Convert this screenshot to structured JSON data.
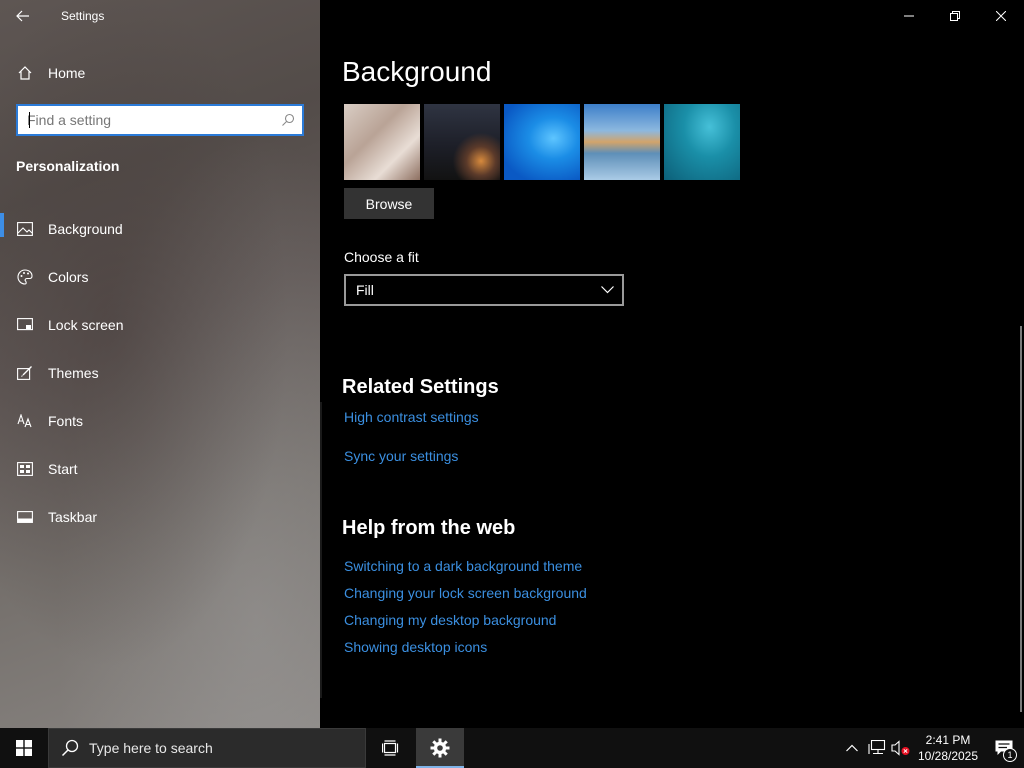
{
  "window": {
    "app_title": "Settings",
    "controls": [
      "minimize",
      "restore",
      "close"
    ]
  },
  "sidebar": {
    "home_label": "Home",
    "search_placeholder": "Find a setting",
    "section_title": "Personalization",
    "items": [
      {
        "label": "Background",
        "icon": "picture-icon",
        "active": true
      },
      {
        "label": "Colors",
        "icon": "palette-icon",
        "active": false
      },
      {
        "label": "Lock screen",
        "icon": "lock-screen-icon",
        "active": false
      },
      {
        "label": "Themes",
        "icon": "themes-icon",
        "active": false
      },
      {
        "label": "Fonts",
        "icon": "fonts-icon",
        "active": false
      },
      {
        "label": "Start",
        "icon": "start-icon",
        "active": false
      },
      {
        "label": "Taskbar",
        "icon": "taskbar-icon",
        "active": false
      }
    ]
  },
  "main": {
    "page_title": "Background",
    "browse_label": "Browse",
    "fit_label": "Choose a fit",
    "fit_value": "Fill",
    "related_title": "Related Settings",
    "related_links": [
      "High contrast settings",
      "Sync your settings"
    ],
    "help_title": "Help from the web",
    "help_links": [
      "Switching to a dark background theme",
      "Changing your lock screen background",
      "Changing my desktop background",
      "Showing desktop icons"
    ]
  },
  "taskbar": {
    "search_placeholder": "Type here to search",
    "time": "2:41 PM",
    "date": "10/28/2025",
    "notification_count": "1"
  },
  "colors": {
    "accent": "#3d8ee6",
    "link": "#3b8fe0",
    "background": "#000000"
  }
}
